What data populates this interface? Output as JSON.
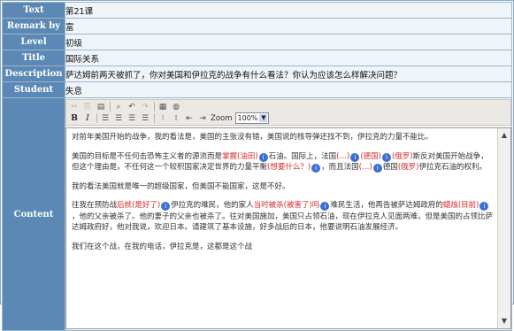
{
  "form": {
    "rows": [
      {
        "label": "Text",
        "value": "第21课"
      },
      {
        "label": "Remark by",
        "value": "富"
      },
      {
        "label": "Level",
        "value": "初级"
      },
      {
        "label": "Title",
        "value": "国际关系"
      },
      {
        "label": "Description",
        "value": "萨达姆前两天被抓了，你对美国和伊拉克的战争有什么看法？你认为应该怎么样解决问题？"
      },
      {
        "label": "Student",
        "value": "失息"
      }
    ],
    "content_label": "Content"
  },
  "toolbar": {
    "zoom_label": "Zoom",
    "zoom_value": "100%",
    "icons_row1": [
      "cut-icon",
      "copy-icon",
      "paste-icon",
      "find-icon",
      "undo-icon",
      "redo-icon",
      "table-icon",
      "image-icon"
    ],
    "bold": "B",
    "italic": "I"
  },
  "document": {
    "p1": "对前年美国开始的战争，我的看法是，美国的主张没有错，美国说的核导弹还找不到，伊拉克的力量不能比。",
    "p2a": "美国的目标是不任何击恐怖主义者的源流而是",
    "p2b": "掌握(油田)",
    "p2c": "石油。国际上，法国",
    "p2d": "(…)",
    "p2e": "",
    "p2f": "(德国)",
    "p2g": "",
    "p2h": "(俄罗)",
    "p2i": "斯反对美国开始战争，但这个理由是，不任何这一个较积国家决定世界的力量平衡",
    "p2j": "(想要什么？)",
    "p2k": "，而且法国",
    "p2l": "(…)",
    "p2m": "德国",
    "p2n": "(俄罗)",
    "p2o": "伊拉克石油的权利。",
    "p3": "我的看法美国就是唯一的超级国家，但美国不能国家，这是不好。",
    "p4a": "往我在预防战",
    "p4b": "后就(是好了)",
    "p4c": "伊拉克的难民，他的家人",
    "p4d": "当时被杀(被害了)吗",
    "p4e": "难民生活，他再告被萨达姆政府的",
    "p4f": "蜡烛",
    "p4g": "(目前)",
    "p4h": "，他的父亲被杀了。他的妻子的父亲也被杀了。往对美国施加，美国只占领石油，现在伊拉克人见面两难，但是美国的占领比萨达姆政府好，他对我说，欢迎日本。请建筑了基本设施，好多战后的日本，他要说明石油发展经济。",
    "p5": "我们在这个战，在我的电话，伊拉克是，这都是这个战"
  }
}
